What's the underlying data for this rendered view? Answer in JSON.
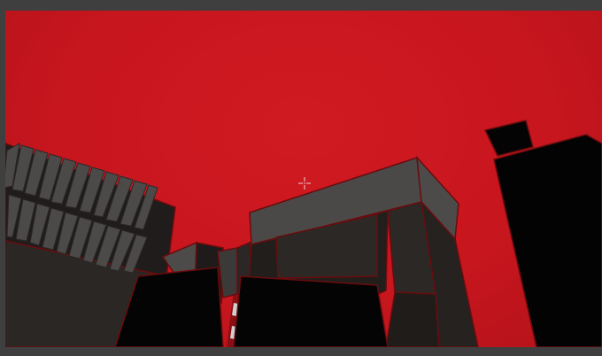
{
  "scene": {
    "type": "first-person game view",
    "sky_color": "#cc161f",
    "building_dark": "#211e1c",
    "building_mid": "#3a3735",
    "building_light": "#4a4948",
    "outline": "#7b0d10"
  },
  "hud": {
    "crosshair_icon": "crosshair-icon"
  }
}
